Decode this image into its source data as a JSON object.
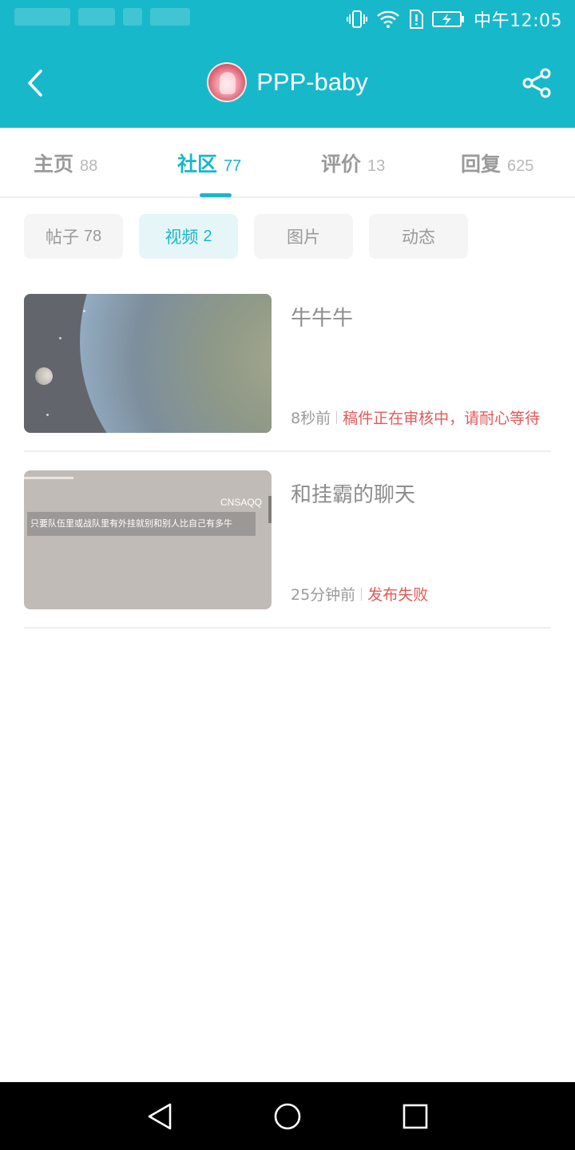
{
  "status_bar": {
    "time": "中午12:05",
    "icons": [
      "vibrate-icon",
      "wifi-icon",
      "sim-alert-icon",
      "battery-charging-icon"
    ]
  },
  "header": {
    "title": "PPP-baby",
    "back_icon": "back-arrow-icon",
    "share_icon": "share-icon",
    "accent": "#17b8c9"
  },
  "tabs": [
    {
      "label": "主页",
      "count": "88"
    },
    {
      "label": "社区",
      "count": "77",
      "active": true
    },
    {
      "label": "评价",
      "count": "13"
    },
    {
      "label": "回复",
      "count": "625"
    }
  ],
  "filters": [
    {
      "label": "帖子",
      "count": "78"
    },
    {
      "label": "视频",
      "count": "2",
      "active": true
    },
    {
      "label": "图片",
      "count": ""
    },
    {
      "label": "动态",
      "count": ""
    }
  ],
  "posts": [
    {
      "title": "牛牛牛",
      "time": "8秒前",
      "status": "稿件正在审核中，请耐心等待"
    },
    {
      "title": "和挂霸的聊天",
      "time": "25分钟前",
      "status": "发布失败",
      "thumb_tag": "CNSAQQ",
      "thumb_caption": "只要队伍里或战队里有外挂就别和别人比自己有多牛"
    }
  ],
  "status_color": "#e05a5a",
  "nav_bar": [
    "nav-back-icon",
    "nav-home-icon",
    "nav-recent-icon"
  ]
}
